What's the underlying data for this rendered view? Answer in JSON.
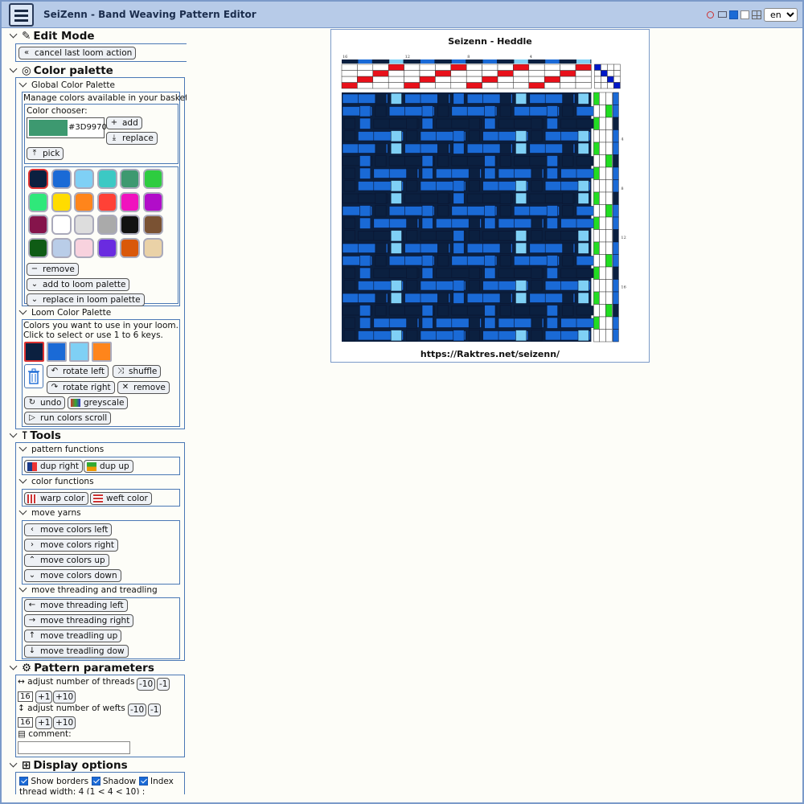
{
  "header": {
    "title": "SeiZenn - Band Weaving Pattern Editor",
    "language": "en",
    "language_options": [
      "en"
    ]
  },
  "edit_mode": {
    "title": "Edit Mode",
    "cancel_label": "cancel last loom action"
  },
  "color_palette": {
    "title": "Color palette",
    "global": {
      "title": "Global Color Palette",
      "description": "Manage colors available in your basket",
      "chooser_label": "Color chooser:",
      "chooser_color": "#3D9970",
      "chooser_hex": "#3D9970",
      "add_label": "add",
      "replace_label": "replace",
      "pick_label": "pick",
      "remove_label": "remove",
      "add_loom_label": "add to loom palette",
      "replace_loom_label": "replace in loom palette",
      "swatches": [
        "#0b2040",
        "#1a6ad6",
        "#7fd0f5",
        "#3cc9c4",
        "#3d9970",
        "#2ecc40",
        "#2fe87a",
        "#ffdc00",
        "#ff851b",
        "#ff4136",
        "#f012be",
        "#b10dc9",
        "#85144b",
        "#ffffff",
        "#dddddd",
        "#aaaaaa",
        "#111111",
        "#7a5233",
        "#0f5c15",
        "#b9cde8",
        "#f8d2de",
        "#6a2be0",
        "#d9580a",
        "#ead2a7"
      ]
    },
    "loom": {
      "title": "Loom Color Palette",
      "line1": "Colors you want to use in your loom.",
      "line2": "Click to select or use 1 to 6 keys.",
      "swatches": [
        "#0b2040",
        "#1a6ad6",
        "#7fd0f5",
        "#ff851b"
      ],
      "rotate_left": "rotate left",
      "shuffle": "shuffle",
      "rotate_right": "rotate right",
      "remove": "remove",
      "undo": "undo",
      "greyscale": "greyscale",
      "run_scroll": "run colors scroll"
    }
  },
  "tools": {
    "title": "Tools",
    "pattern_functions": "pattern functions",
    "dup_right": "dup right",
    "dup_up": "dup up",
    "color_functions": "color functions",
    "warp_color": "warp color",
    "weft_color": "weft color",
    "move_yarns": "move yarns",
    "move_colors_left": "move colors left",
    "move_colors_right": "move colors right",
    "move_colors_up": "move colors up",
    "move_colors_down": "move colors down",
    "move_threading": "move threading and treadling",
    "move_threading_left": "move threading left",
    "move_threading_right": "move threading right",
    "move_treadling_up": "move treadling up",
    "move_treadling_down": "move treadling dow"
  },
  "params": {
    "title": "Pattern parameters",
    "threads_label": "adjust number of threads",
    "threads_value": "16",
    "wefts_label": "adjust number of wefts",
    "wefts_value": "16",
    "minus10": "-10",
    "minus1": "-1",
    "plus1": "+1",
    "plus10": "+10",
    "comment_label": "comment:"
  },
  "display": {
    "title": "Display options",
    "show_borders": "Show borders",
    "shadow": "Shadow",
    "index": "Index",
    "thread_width": "thread width: 4 (1 < 4 < 10) :"
  },
  "draft": {
    "title": "Seizenn - Heddle",
    "url": "https://Raktres.net/seizenn/",
    "top_ticks": [
      "16",
      "12",
      "8",
      "4"
    ],
    "side_ticks": [
      "4",
      "8",
      "12",
      "16"
    ],
    "colors": {
      "dark": "#0b2040",
      "blue": "#1a6ad6",
      "light": "#7fd0f5",
      "red": "#e8101a",
      "green": "#22dd22",
      "tieup": "#0018c8"
    },
    "warp_colors": [
      0,
      1,
      0,
      2,
      0,
      1,
      0,
      1,
      0,
      1,
      0,
      2,
      0,
      1,
      0,
      2
    ],
    "weft_colors": [
      1,
      1,
      0,
      1,
      1,
      0,
      1,
      1,
      0,
      1,
      1,
      0,
      1,
      1,
      0,
      1,
      1,
      0,
      1,
      1
    ],
    "threading": [
      0,
      1,
      2,
      3,
      0,
      1,
      2,
      3,
      0,
      1,
      2,
      3,
      0,
      1,
      2,
      3
    ]
  }
}
